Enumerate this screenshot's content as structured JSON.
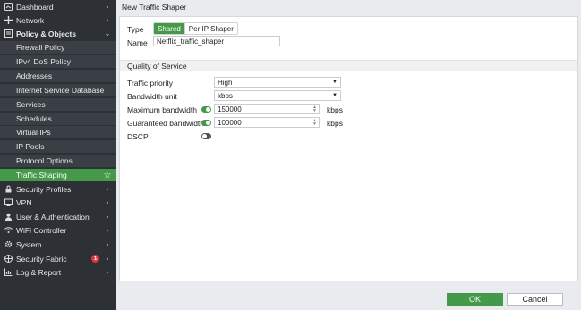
{
  "header": {
    "title": "New Traffic Shaper"
  },
  "sidebar": {
    "items": [
      {
        "label": "Dashboard",
        "icon": "dashboard-icon"
      },
      {
        "label": "Network",
        "icon": "network-icon"
      },
      {
        "label": "Policy & Objects",
        "icon": "policy-icon"
      },
      {
        "label": "Firewall Policy"
      },
      {
        "label": "IPv4 DoS Policy"
      },
      {
        "label": "Addresses"
      },
      {
        "label": "Internet Service Database"
      },
      {
        "label": "Services"
      },
      {
        "label": "Schedules"
      },
      {
        "label": "Virtual IPs"
      },
      {
        "label": "IP Pools"
      },
      {
        "label": "Protocol Options"
      },
      {
        "label": "Traffic Shaping"
      },
      {
        "label": "Security Profiles",
        "icon": "lock-icon"
      },
      {
        "label": "VPN",
        "icon": "monitor-icon"
      },
      {
        "label": "User & Authentication",
        "icon": "user-icon"
      },
      {
        "label": "WiFi Controller",
        "icon": "wifi-icon"
      },
      {
        "label": "System",
        "icon": "gear-icon"
      },
      {
        "label": "Security Fabric",
        "icon": "fabric-icon",
        "badge": "1"
      },
      {
        "label": "Log & Report",
        "icon": "chart-icon"
      }
    ]
  },
  "form": {
    "type_label": "Type",
    "type_options": [
      "Shared",
      "Per IP Shaper"
    ],
    "name_label": "Name",
    "name_value": "Netflix_traffic_shaper",
    "section_title": "Quality of Service",
    "priority_label": "Traffic priority",
    "priority_value": "High",
    "bw_unit_label": "Bandwidth unit",
    "bw_unit_value": "kbps",
    "max_bw_label": "Maximum bandwidth",
    "max_bw_value": "150000",
    "max_bw_unit": "kbps",
    "guar_bw_label": "Guaranteed bandwidth",
    "guar_bw_value": "100000",
    "guar_bw_unit": "kbps",
    "dscp_label": "DSCP"
  },
  "footer": {
    "ok_label": "OK",
    "cancel_label": "Cancel"
  },
  "colors": {
    "accent": "#459a4a",
    "sidebar_bg": "#2d3136",
    "badge": "#e0363b"
  }
}
